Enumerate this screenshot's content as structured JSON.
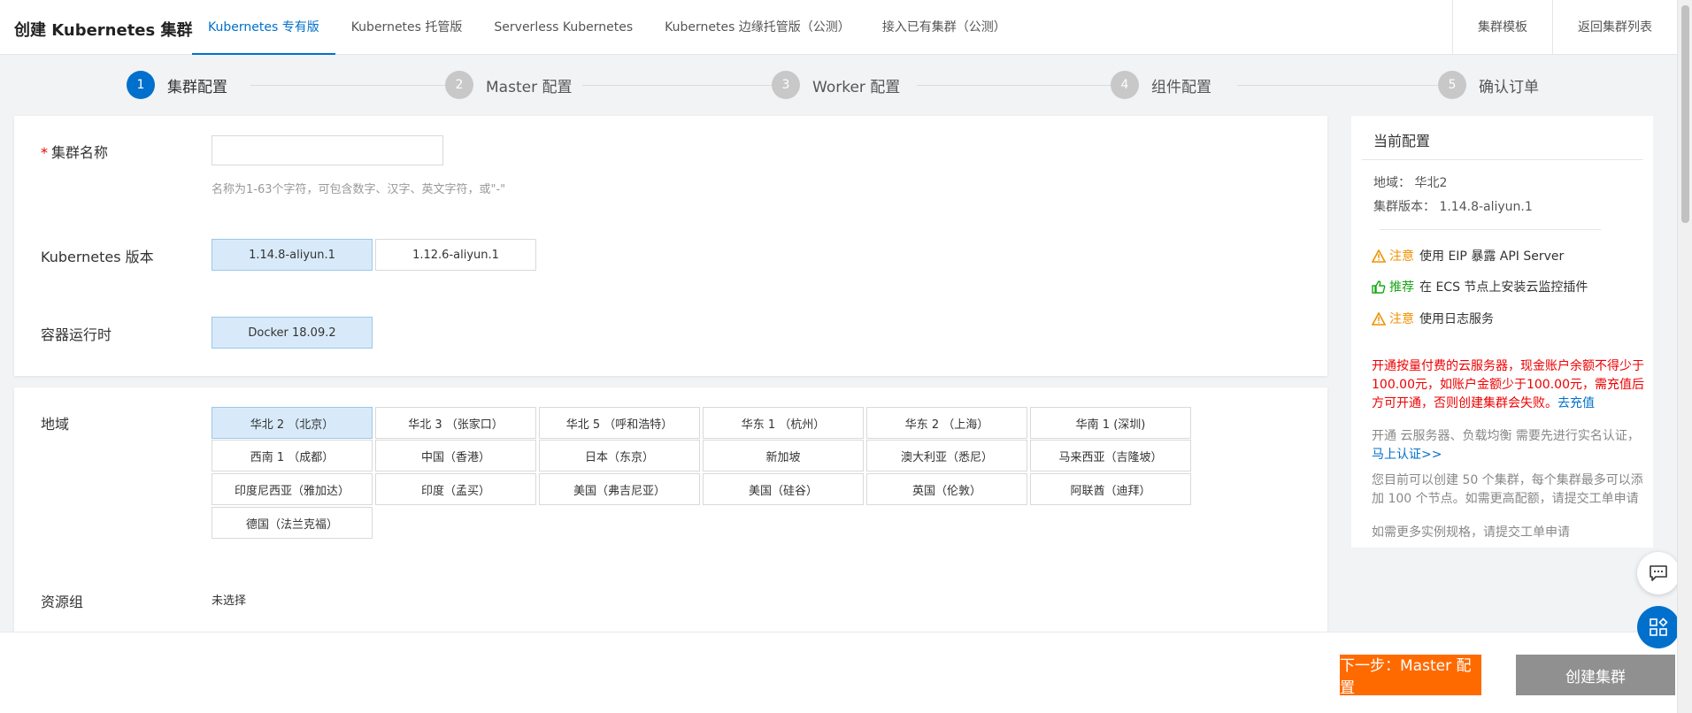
{
  "header": {
    "title": "创建 Kubernetes 集群",
    "tabs": [
      {
        "label": "Kubernetes 专有版",
        "active": true
      },
      {
        "label": "Kubernetes 托管版"
      },
      {
        "label": "Serverless Kubernetes"
      },
      {
        "label": "Kubernetes 边缘托管版（公测）"
      },
      {
        "label": "接入已有集群（公测）"
      }
    ],
    "actions": [
      "集群模板",
      "返回集群列表"
    ]
  },
  "steps": [
    {
      "num": "1",
      "label": "集群配置",
      "active": true
    },
    {
      "num": "2",
      "label": "Master 配置"
    },
    {
      "num": "3",
      "label": "Worker 配置"
    },
    {
      "num": "4",
      "label": "组件配置"
    },
    {
      "num": "5",
      "label": "确认订单"
    }
  ],
  "form": {
    "cluster_name": {
      "star": "*",
      "label": "集群名称",
      "value": "",
      "hint": "名称为1-63个字符，可包含数字、汉字、英文字符，或\"-\""
    },
    "k8s_version": {
      "label": "Kubernetes 版本",
      "options": [
        "1.14.8-aliyun.1",
        "1.12.6-aliyun.1"
      ],
      "selected": "1.14.8-aliyun.1"
    },
    "runtime": {
      "label": "容器运行时",
      "options": [
        "Docker 18.09.2"
      ],
      "selected": "Docker 18.09.2"
    },
    "region": {
      "label": "地域",
      "options": [
        "华北 2 （北京）",
        "华北 3 （张家口）",
        "华北 5 （呼和浩特）",
        "华东 1 （杭州）",
        "华东 2 （上海）",
        "华南 1 (深圳)",
        "西南 1 （成都）",
        "中国（香港）",
        "日本（东京）",
        "新加坡",
        "澳大利亚（悉尼）",
        "马来西亚（吉隆坡）",
        "印度尼西亚（雅加达）",
        "印度（孟买）",
        "美国（弗吉尼亚）",
        "美国（硅谷）",
        "英国（伦敦）",
        "阿联酋（迪拜）",
        "德国（法兰克福）"
      ],
      "selected": "华北 2 （北京）"
    },
    "resource_group": {
      "label": "资源组",
      "value": "未选择"
    }
  },
  "sidebar": {
    "title": "当前配置",
    "region_line": "地域： 华北2",
    "version_line": "集群版本： 1.14.8-aliyun.1",
    "tips": [
      {
        "type": "warn",
        "tag": "注意",
        "text": "使用 EIP 暴露 API Server"
      },
      {
        "type": "rec",
        "tag": "推荐",
        "text": "在 ECS 节点上安装云监控插件"
      },
      {
        "type": "warn",
        "tag": "注意",
        "text": "使用日志服务"
      }
    ],
    "balance_warning": "开通按量付费的云服务器，现金账户余额不得少于100.00元，如账户金额少于100.00元，需充值后方可开通，否则创建集群会失败。",
    "recharge_link": "去充值",
    "auth_text": "开通 云服务器、负载均衡 需要先进行实名认证，",
    "auth_link": "马上认证>>",
    "quota_text": "您目前可以创建 50 个集群，每个集群最多可以添加 100 个节点。如需更高配额，请提交工单申请",
    "more_specs_text": "如需更多实例规格，请提交工单申请"
  },
  "footer": {
    "next_label": "下一步：Master 配置",
    "create_label": "创建集群"
  },
  "colors": {
    "primary": "#0070cc",
    "orange": "#ff6a00",
    "selected_bg": "#d8eaf9",
    "warn": "#f19000",
    "recommend": "#18a515",
    "error": "#e00000"
  },
  "icons": [
    "warning-icon",
    "thumbs-up-icon",
    "chat-icon",
    "apps-icon"
  ]
}
